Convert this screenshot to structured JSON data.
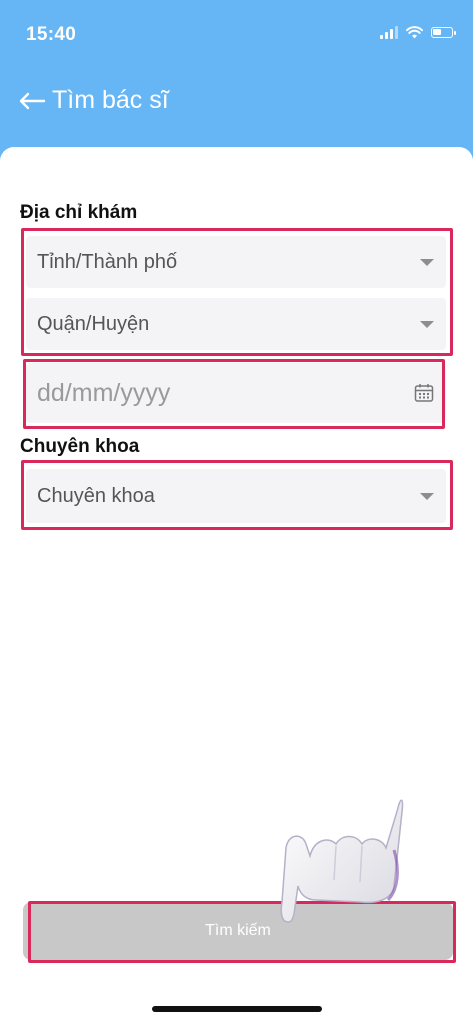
{
  "status_bar": {
    "time": "15:40",
    "icons": [
      "signal-icon",
      "wifi-icon",
      "battery-icon"
    ]
  },
  "header": {
    "back_icon": "arrow-left-icon",
    "title": "Tìm bác sĩ",
    "background_color": "#66b5f5"
  },
  "form": {
    "address_label": "Địa chỉ khám",
    "province_placeholder": "Tỉnh/Thành phố",
    "district_placeholder": "Quận/Huyện",
    "date_placeholder": "dd/mm/yyyy",
    "date_icon": "calendar-icon",
    "specialty_label": "Chuyên khoa",
    "specialty_placeholder": "Chuyên khoa"
  },
  "search_button": {
    "label": "Tìm kiếm"
  },
  "colors": {
    "highlight": "#d9285c",
    "field_bg": "#f4f4f6",
    "button_disabled": "#c8c8c8"
  }
}
